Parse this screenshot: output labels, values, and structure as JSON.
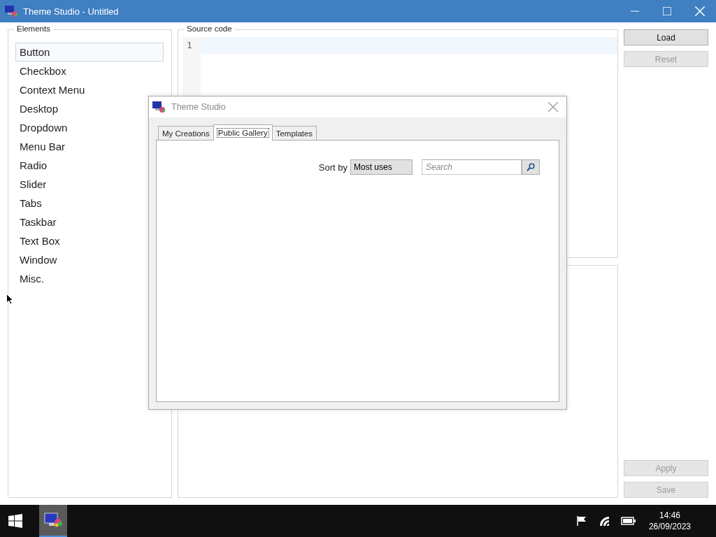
{
  "window": {
    "title": "Theme Studio - Untitled"
  },
  "elements_panel": {
    "label": "Elements",
    "items": [
      {
        "label": "Button",
        "selected": true
      },
      {
        "label": "Checkbox",
        "selected": false
      },
      {
        "label": "Context Menu",
        "selected": false
      },
      {
        "label": "Desktop",
        "selected": false
      },
      {
        "label": "Dropdown",
        "selected": false
      },
      {
        "label": "Menu Bar",
        "selected": false
      },
      {
        "label": "Radio",
        "selected": false
      },
      {
        "label": "Slider",
        "selected": false
      },
      {
        "label": "Tabs",
        "selected": false
      },
      {
        "label": "Taskbar",
        "selected": false
      },
      {
        "label": "Text Box",
        "selected": false
      },
      {
        "label": "Window",
        "selected": false
      },
      {
        "label": "Misc.",
        "selected": false
      }
    ]
  },
  "source_panel": {
    "label": "Source code",
    "line_numbers": [
      "1"
    ]
  },
  "top_buttons": [
    {
      "label": "Load",
      "disabled": false
    },
    {
      "label": "Reset",
      "disabled": true
    }
  ],
  "bottom_buttons": [
    {
      "label": "Apply",
      "disabled": true
    },
    {
      "label": "Save",
      "disabled": true
    }
  ],
  "dialog": {
    "title": "Theme Studio",
    "tabs": [
      {
        "label": "My Creations",
        "selected": false
      },
      {
        "label": "Public Gallery",
        "selected": true
      },
      {
        "label": "Templates",
        "selected": false
      }
    ],
    "sort_label": "Sort by",
    "sort_value": "Most uses",
    "search": {
      "placeholder": "Search"
    }
  },
  "taskbar": {
    "time": "14:46",
    "date": "26/09/2023"
  }
}
